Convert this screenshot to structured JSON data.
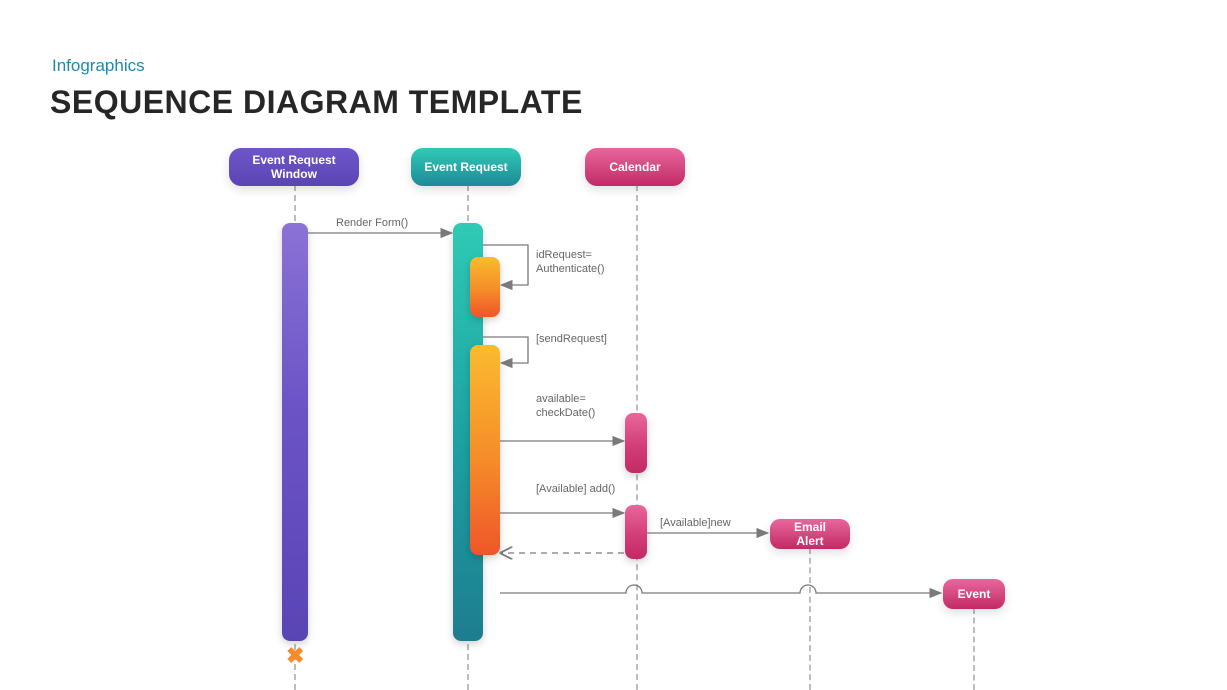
{
  "subtitle": "Infographics",
  "title": "SEQUENCE DIAGRAM TEMPLATE",
  "actors": {
    "eventRequestWindow": "Event Request Window",
    "eventRequest": "Event  Request",
    "calendar": "Calendar",
    "emailAlert": "Email Alert",
    "event": "Event"
  },
  "messages": {
    "renderForm": "Render Form()",
    "authenticate": "idRequest= Authenticate()",
    "sendRequest": "[sendRequest]",
    "checkDate": "available= checkDate()",
    "availableAdd": "[Available] add()",
    "availableNew": "[Available]new"
  }
}
